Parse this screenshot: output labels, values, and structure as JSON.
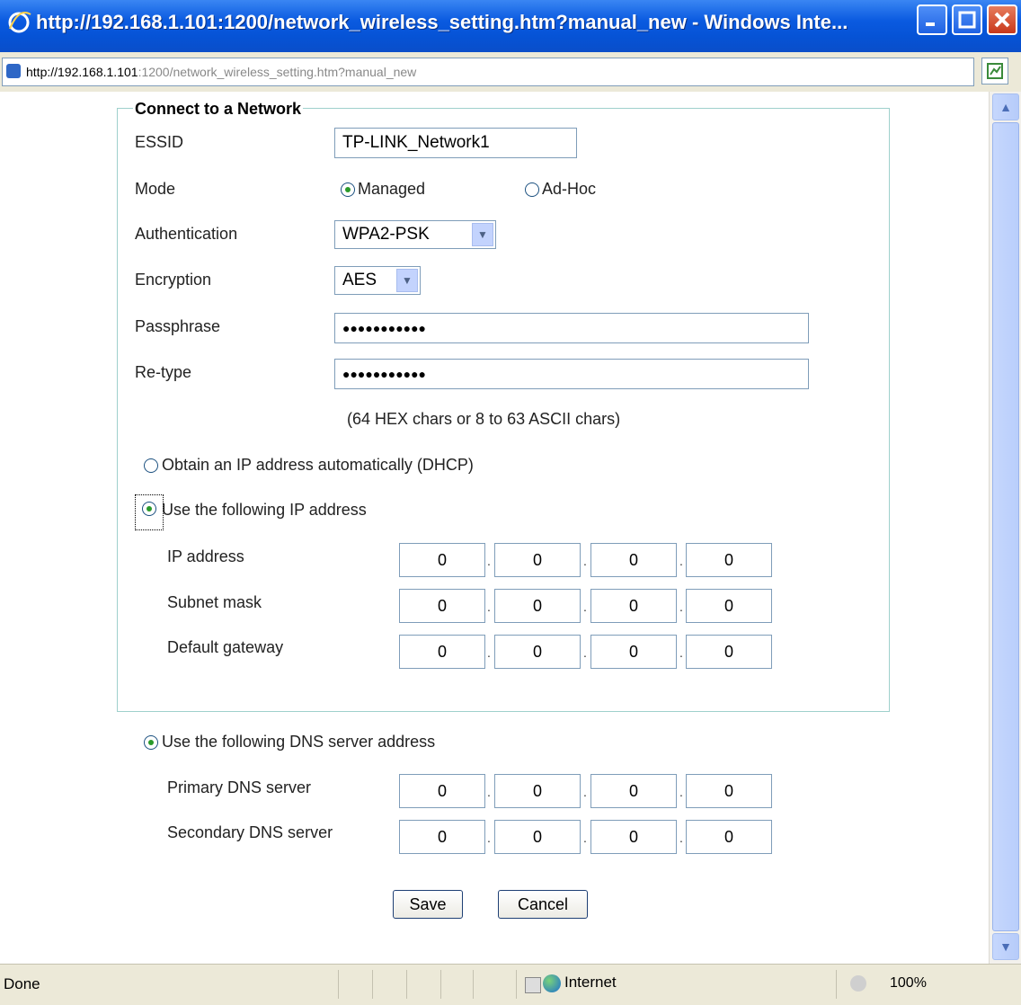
{
  "window": {
    "title": "http://192.168.1.101:1200/network_wireless_setting.htm?manual_new - Windows Inte...",
    "address_host": "http://192.168.1.101",
    "address_rest": ":1200/network_wireless_setting.htm?manual_new"
  },
  "form": {
    "legend": "Connect to a Network",
    "essid_label": "ESSID",
    "essid_value": "TP-LINK_Network1",
    "mode_label": "Mode",
    "mode_managed": "Managed",
    "mode_adhoc": "Ad-Hoc",
    "auth_label": "Authentication",
    "auth_value": "WPA2-PSK",
    "enc_label": "Encryption",
    "enc_value": "AES",
    "pass_label": "Passphrase",
    "pass_value": "●●●●●●●●●●●",
    "retype_label": "Re-type",
    "retype_value": "●●●●●●●●●●●",
    "hint": "(64 HEX chars or 8 to 63 ASCII chars)",
    "dhcp_label": "Obtain an IP address automatically (DHCP)",
    "static_label": "Use the following IP address",
    "ip_label": "IP address",
    "subnet_label": "Subnet mask",
    "gateway_label": "Default gateway",
    "dns_label": "Use the following DNS server address",
    "primary_dns_label": "Primary DNS server",
    "secondary_dns_label": "Secondary DNS server",
    "octet": "0"
  },
  "buttons": {
    "save": "Save",
    "cancel": "Cancel"
  },
  "status": {
    "text": "Done",
    "zone": "Internet",
    "zoom": "100%"
  },
  "colors": {
    "titlebar": "#0653d6",
    "fieldset_border": "#9fd0cc",
    "radio_selected": "#2a9a2a"
  }
}
